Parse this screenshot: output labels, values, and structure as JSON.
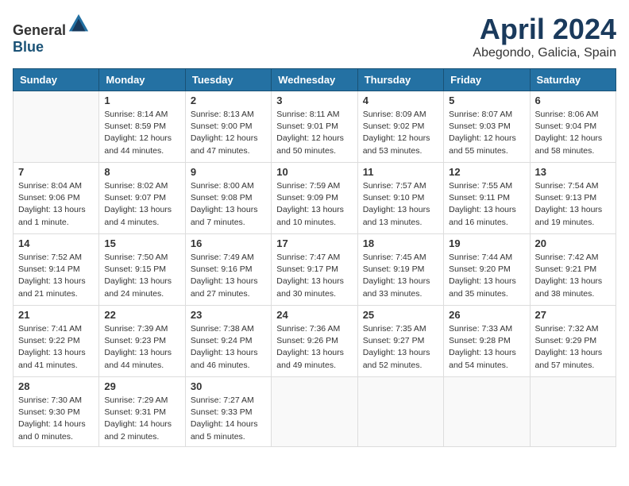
{
  "header": {
    "logo_general": "General",
    "logo_blue": "Blue",
    "month_year": "April 2024",
    "location": "Abegondo, Galicia, Spain"
  },
  "weekdays": [
    "Sunday",
    "Monday",
    "Tuesday",
    "Wednesday",
    "Thursday",
    "Friday",
    "Saturday"
  ],
  "weeks": [
    [
      {
        "day": "",
        "info": ""
      },
      {
        "day": "1",
        "info": "Sunrise: 8:14 AM\nSunset: 8:59 PM\nDaylight: 12 hours\nand 44 minutes."
      },
      {
        "day": "2",
        "info": "Sunrise: 8:13 AM\nSunset: 9:00 PM\nDaylight: 12 hours\nand 47 minutes."
      },
      {
        "day": "3",
        "info": "Sunrise: 8:11 AM\nSunset: 9:01 PM\nDaylight: 12 hours\nand 50 minutes."
      },
      {
        "day": "4",
        "info": "Sunrise: 8:09 AM\nSunset: 9:02 PM\nDaylight: 12 hours\nand 53 minutes."
      },
      {
        "day": "5",
        "info": "Sunrise: 8:07 AM\nSunset: 9:03 PM\nDaylight: 12 hours\nand 55 minutes."
      },
      {
        "day": "6",
        "info": "Sunrise: 8:06 AM\nSunset: 9:04 PM\nDaylight: 12 hours\nand 58 minutes."
      }
    ],
    [
      {
        "day": "7",
        "info": "Sunrise: 8:04 AM\nSunset: 9:06 PM\nDaylight: 13 hours\nand 1 minute."
      },
      {
        "day": "8",
        "info": "Sunrise: 8:02 AM\nSunset: 9:07 PM\nDaylight: 13 hours\nand 4 minutes."
      },
      {
        "day": "9",
        "info": "Sunrise: 8:00 AM\nSunset: 9:08 PM\nDaylight: 13 hours\nand 7 minutes."
      },
      {
        "day": "10",
        "info": "Sunrise: 7:59 AM\nSunset: 9:09 PM\nDaylight: 13 hours\nand 10 minutes."
      },
      {
        "day": "11",
        "info": "Sunrise: 7:57 AM\nSunset: 9:10 PM\nDaylight: 13 hours\nand 13 minutes."
      },
      {
        "day": "12",
        "info": "Sunrise: 7:55 AM\nSunset: 9:11 PM\nDaylight: 13 hours\nand 16 minutes."
      },
      {
        "day": "13",
        "info": "Sunrise: 7:54 AM\nSunset: 9:13 PM\nDaylight: 13 hours\nand 19 minutes."
      }
    ],
    [
      {
        "day": "14",
        "info": "Sunrise: 7:52 AM\nSunset: 9:14 PM\nDaylight: 13 hours\nand 21 minutes."
      },
      {
        "day": "15",
        "info": "Sunrise: 7:50 AM\nSunset: 9:15 PM\nDaylight: 13 hours\nand 24 minutes."
      },
      {
        "day": "16",
        "info": "Sunrise: 7:49 AM\nSunset: 9:16 PM\nDaylight: 13 hours\nand 27 minutes."
      },
      {
        "day": "17",
        "info": "Sunrise: 7:47 AM\nSunset: 9:17 PM\nDaylight: 13 hours\nand 30 minutes."
      },
      {
        "day": "18",
        "info": "Sunrise: 7:45 AM\nSunset: 9:19 PM\nDaylight: 13 hours\nand 33 minutes."
      },
      {
        "day": "19",
        "info": "Sunrise: 7:44 AM\nSunset: 9:20 PM\nDaylight: 13 hours\nand 35 minutes."
      },
      {
        "day": "20",
        "info": "Sunrise: 7:42 AM\nSunset: 9:21 PM\nDaylight: 13 hours\nand 38 minutes."
      }
    ],
    [
      {
        "day": "21",
        "info": "Sunrise: 7:41 AM\nSunset: 9:22 PM\nDaylight: 13 hours\nand 41 minutes."
      },
      {
        "day": "22",
        "info": "Sunrise: 7:39 AM\nSunset: 9:23 PM\nDaylight: 13 hours\nand 44 minutes."
      },
      {
        "day": "23",
        "info": "Sunrise: 7:38 AM\nSunset: 9:24 PM\nDaylight: 13 hours\nand 46 minutes."
      },
      {
        "day": "24",
        "info": "Sunrise: 7:36 AM\nSunset: 9:26 PM\nDaylight: 13 hours\nand 49 minutes."
      },
      {
        "day": "25",
        "info": "Sunrise: 7:35 AM\nSunset: 9:27 PM\nDaylight: 13 hours\nand 52 minutes."
      },
      {
        "day": "26",
        "info": "Sunrise: 7:33 AM\nSunset: 9:28 PM\nDaylight: 13 hours\nand 54 minutes."
      },
      {
        "day": "27",
        "info": "Sunrise: 7:32 AM\nSunset: 9:29 PM\nDaylight: 13 hours\nand 57 minutes."
      }
    ],
    [
      {
        "day": "28",
        "info": "Sunrise: 7:30 AM\nSunset: 9:30 PM\nDaylight: 14 hours\nand 0 minutes."
      },
      {
        "day": "29",
        "info": "Sunrise: 7:29 AM\nSunset: 9:31 PM\nDaylight: 14 hours\nand 2 minutes."
      },
      {
        "day": "30",
        "info": "Sunrise: 7:27 AM\nSunset: 9:33 PM\nDaylight: 14 hours\nand 5 minutes."
      },
      {
        "day": "",
        "info": ""
      },
      {
        "day": "",
        "info": ""
      },
      {
        "day": "",
        "info": ""
      },
      {
        "day": "",
        "info": ""
      }
    ]
  ]
}
